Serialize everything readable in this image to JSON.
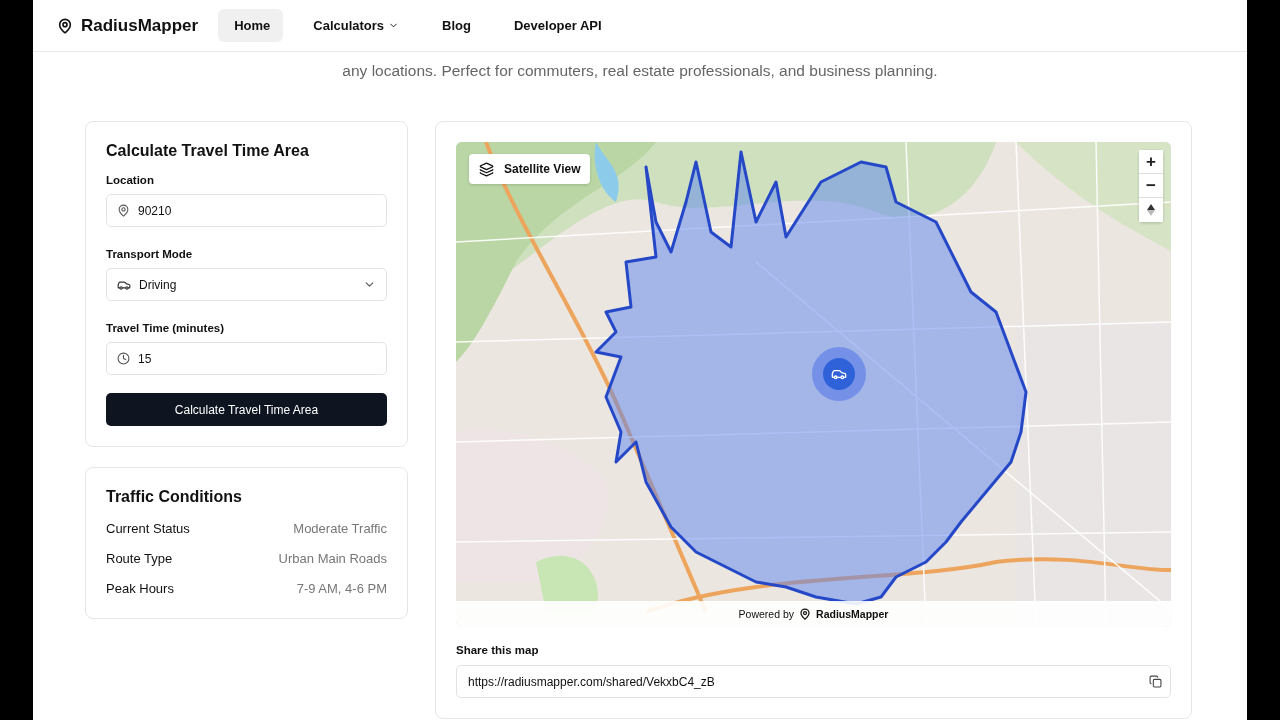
{
  "header": {
    "brand": "RadiusMapper",
    "nav": [
      {
        "label": "Home",
        "selected": true,
        "has_menu": false
      },
      {
        "label": "Calculators",
        "selected": false,
        "has_menu": true
      },
      {
        "label": "Blog",
        "selected": false,
        "has_menu": false
      },
      {
        "label": "Developer API",
        "selected": false,
        "has_menu": false
      }
    ]
  },
  "intro": "any locations. Perfect for commuters, real estate professionals, and business planning.",
  "calculator": {
    "title": "Calculate Travel Time Area",
    "fields": [
      {
        "kind": "text",
        "label": "Location",
        "value": "90210"
      },
      {
        "kind": "select",
        "label": "Transport Mode",
        "value": "Driving"
      },
      {
        "kind": "number",
        "label": "Travel Time (minutes)",
        "value": "15"
      }
    ],
    "submit": "Calculate Travel Time Area"
  },
  "traffic": {
    "title": "Traffic Conditions",
    "rows": [
      {
        "label": "Current Status",
        "value": "Moderate Traffic"
      },
      {
        "label": "Route Type",
        "value": "Urban Main Roads"
      },
      {
        "label": "Peak Hours",
        "value": "7-9 AM, 4-6 PM"
      }
    ]
  },
  "map": {
    "layer_button": "Satellite View",
    "zoom_in": "+",
    "zoom_out": "−",
    "attribution": {
      "prefix": "Powered by",
      "brand": "RadiusMapper"
    }
  },
  "share": {
    "label": "Share this map",
    "url": "https://radiusmapper.com/shared/VekxbC4_zB"
  }
}
